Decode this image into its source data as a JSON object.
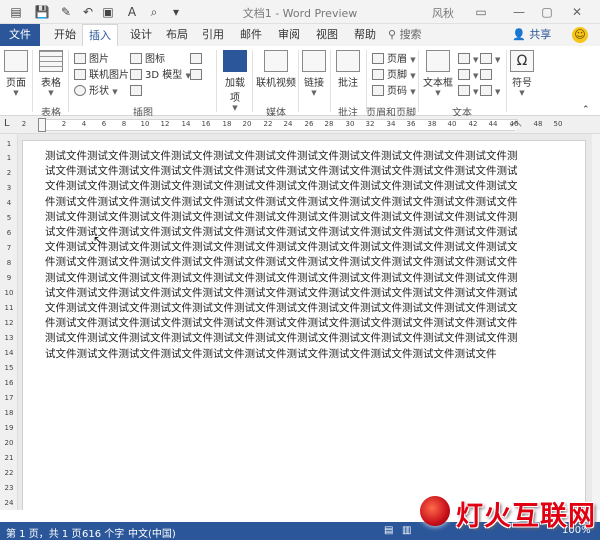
{
  "window": {
    "title": "文档1 - Word Preview",
    "user": "风秋",
    "controls": {
      "minimize": "—",
      "restore": "▢",
      "close": "✕"
    }
  },
  "quick_access": [
    "save-icon",
    "undo-icon",
    "redo-icon",
    "touch-mode-icon",
    "print-icon",
    "preview-icon",
    "customize-icon"
  ],
  "tabs": [
    {
      "label": "文件"
    },
    {
      "label": "开始"
    },
    {
      "label": "插入",
      "active": true
    },
    {
      "label": "设计"
    },
    {
      "label": "布局"
    },
    {
      "label": "引用"
    },
    {
      "label": "邮件"
    },
    {
      "label": "审阅"
    },
    {
      "label": "视图"
    },
    {
      "label": "帮助"
    }
  ],
  "search": {
    "label": "搜索"
  },
  "share": {
    "label": "共享"
  },
  "ribbon": {
    "pages": "页面",
    "table": "表格",
    "picture": "图片",
    "online_picture": "联机图片",
    "shapes": "形状",
    "icons": "图标",
    "model_3d": "3D 模型",
    "addins": "加载项",
    "online_video": "联机视频",
    "link": "链接",
    "comment": "批注",
    "header": "页眉",
    "footer": "页脚",
    "page_number": "页码",
    "textbox": "文本框",
    "symbol": "符号",
    "groups": {
      "tables": "表格",
      "illustrations": "插图",
      "media": "媒体",
      "comments": "批注",
      "header_footer": "页眉和页脚",
      "text": "文本"
    }
  },
  "ruler": {
    "corner": "L",
    "ticks": [
      "2",
      "2",
      "4",
      "6",
      "8",
      "10",
      "12",
      "14",
      "16",
      "18",
      "20",
      "22",
      "24",
      "26",
      "28",
      "30",
      "32",
      "34",
      "36",
      "38",
      "40",
      "42",
      "44",
      "46",
      "48",
      "50"
    ],
    "vticks": [
      "1",
      "1",
      "2",
      "3",
      "4",
      "5",
      "6",
      "7",
      "8",
      "9",
      "10",
      "11",
      "12",
      "13",
      "14",
      "15",
      "16",
      "17",
      "18",
      "19",
      "20",
      "21",
      "22",
      "23",
      "24"
    ]
  },
  "document": {
    "body": "测试文件测试文件测试文件测试文件测试文件测试文件测试文件测试文件测试文件测试文件测试文件测试文件测试文件测试文件测试文件测试文件测试文件测试文件测试文件测试文件测试文件测试文件测试文件测试文件测试文件测试文件测试文件测试文件测试文件测试文件测试文件测试文件测试文件测试文件测试文件测试文件测试文件测试文件测试文件测试文件测试文件测试文件测试文件测试文件测试文件测试文件测试文件测试文件测试文件测试文件测试文件测试文件测试文件测试文件测试文件测试文件测试文件测试文件测试文件测试文件测试文件测试文件测试文件测试文件测试文件测试文件测试文件测试文件测试文件测试文件测试文件测试文件测试文件测试文件测试文件测试文件测试文件测试文件测试文件测试文件测试文件测试文件测试文件测试文件测试文件测试文件测试文件测试文件测试文件测试文件测试文件测试文件测试文件测试文件测试文件测试文件测试文件测试文件测试文件测试文件测试文件测试文件测试文件测试文件测试文件测试文件测试文件测试文件测试文件测试文件测试文件测试文件测试文件测试文件测试文件测试文件测试文件测试文件测试文件测试文件测试文件测试文件测试文件测试文件测试文件测试文件测试文件测试文件测试文件测试文件测试文件测试文件测试文件测试文件测试文件测试文件测试文件测试文件测试文件测试文件测试文件测试文件测试文件测试文件测试文件测试文件测试文件测试文件测试文件测试文件测试文件测试文件测试文件测试文件测试文件测试文件测试文件"
  },
  "status": {
    "page": "第 1 页，共 1 页",
    "words": "616 个字",
    "language": "中文(中国)",
    "zoom": "100%"
  },
  "watermark": {
    "text": "灯火互联网"
  },
  "colors": {
    "accent": "#2b579a",
    "watermark": "#e00012"
  }
}
